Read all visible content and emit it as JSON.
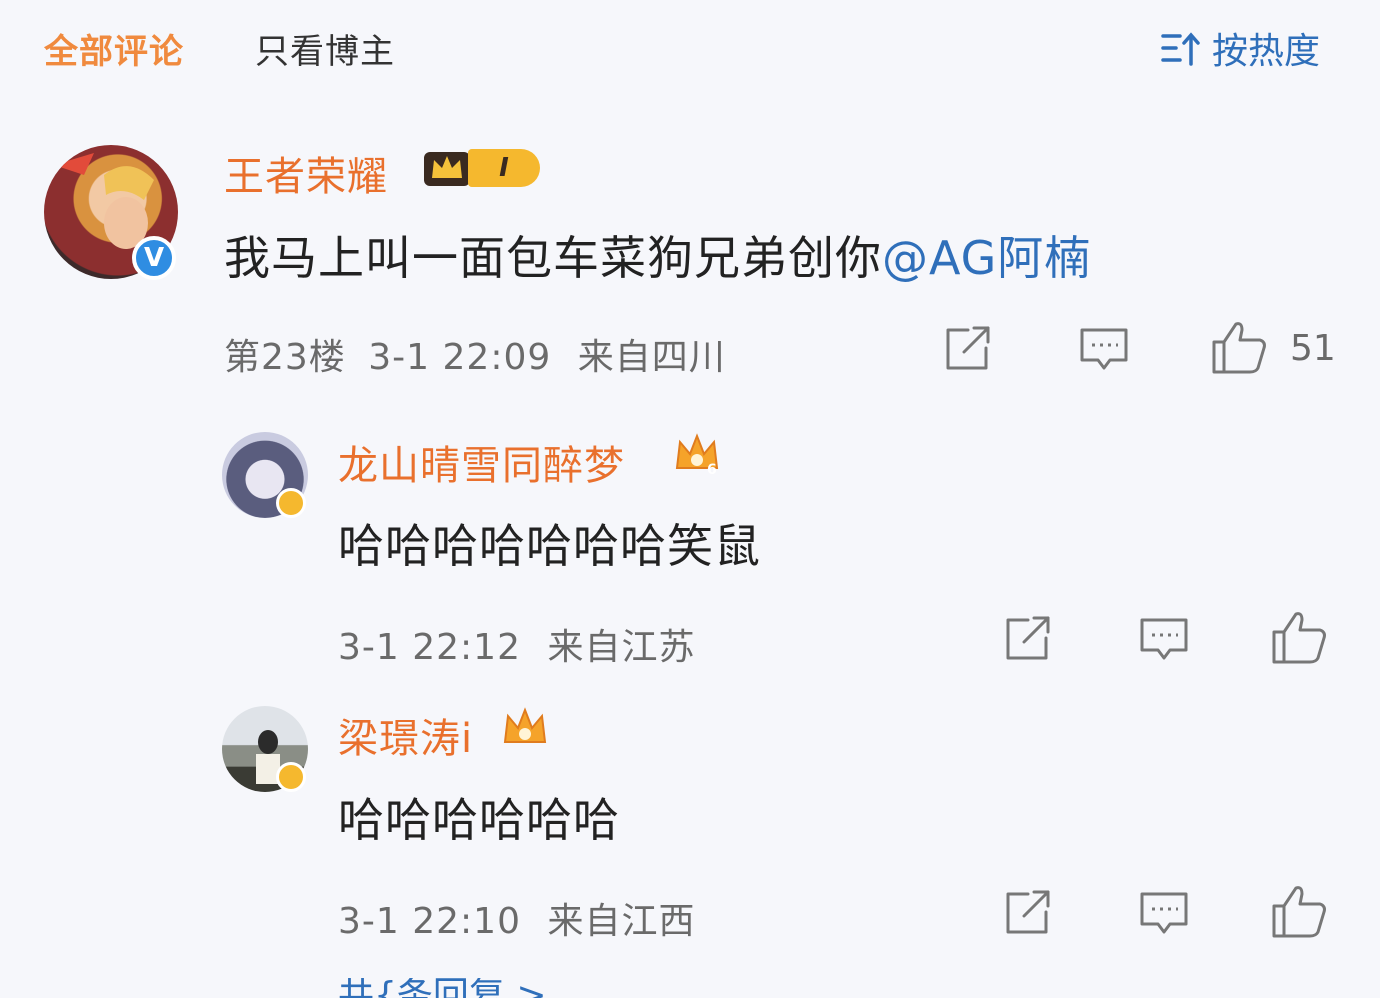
{
  "filters": {
    "all_comments": "全部评论",
    "only_author": "只看博主",
    "sort_by_hot": "按热度"
  },
  "comments": [
    {
      "username": "王者荣耀",
      "level_badge": "I",
      "text_prefix": "我马上叫一面包车菜狗兄弟创你",
      "mention": "@AG阿楠",
      "floor": "第23楼",
      "time": "3-1 22:09",
      "location": "来自四川",
      "likes": "51"
    },
    {
      "username": "龙山晴雪同醉梦",
      "crown_level": "6",
      "text": "哈哈哈哈哈哈哈笑鼠",
      "time": "3-1 22:12",
      "location": "来自江苏"
    },
    {
      "username": "梁璟涛i",
      "text": "哈哈哈哈哈哈",
      "time": "3-1 22:10",
      "location": "来自江西"
    }
  ],
  "more_replies": "共{条回复 >"
}
